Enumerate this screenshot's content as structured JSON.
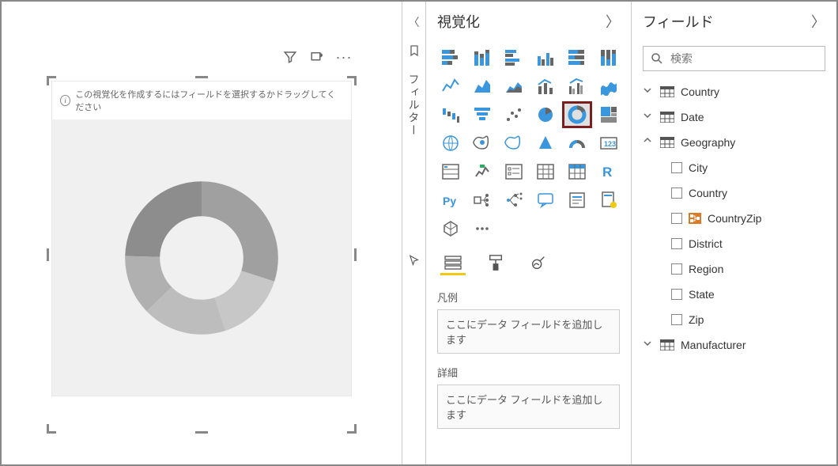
{
  "chart_data": {
    "type": "donut",
    "title": "",
    "values": [
      25,
      15,
      18,
      12,
      30
    ],
    "colors": [
      "#8d8d8d",
      "#c7c7c7",
      "#bdbdbd",
      "#b0b0b0",
      "#a0a0a0"
    ]
  },
  "canvas": {
    "info_message": "この視覚化を作成するにはフィールドを選択するかドラッグしてください"
  },
  "filter_rail": {
    "label": "フィルター"
  },
  "viz_pane": {
    "title": "視覚化",
    "gallery_names": [
      "stacked-bar",
      "stacked-column",
      "clustered-bar",
      "clustered-column",
      "hundred-stacked-bar",
      "hundred-stacked-column",
      "line",
      "area",
      "stacked-area",
      "line-stacked-column",
      "line-clustered-column",
      "ribbon",
      "waterfall",
      "funnel",
      "scatter",
      "pie",
      "donut",
      "treemap",
      "map",
      "filled-map",
      "shape-map",
      "azure-map",
      "gauge",
      "card",
      "multi-row-card",
      "kpi",
      "slicer",
      "table",
      "matrix",
      "r-visual",
      "python-visual",
      "key-influencers",
      "decomposition-tree",
      "qa",
      "narrative",
      "paginated",
      "app-source",
      "more"
    ],
    "selected": "donut",
    "wells": {
      "legend_label": "凡例",
      "legend_placeholder": "ここにデータ フィールドを追加します",
      "details_label": "詳細",
      "details_placeholder": "ここにデータ フィールドを追加します"
    }
  },
  "fields_pane": {
    "title": "フィールド",
    "search_placeholder": "検索",
    "tables": [
      {
        "name": "Country",
        "expanded": false
      },
      {
        "name": "Date",
        "expanded": false
      },
      {
        "name": "Geography",
        "expanded": true,
        "fields": [
          {
            "name": "City",
            "type": "text"
          },
          {
            "name": "Country",
            "type": "text"
          },
          {
            "name": "CountryZip",
            "type": "hierarchy"
          },
          {
            "name": "District",
            "type": "text"
          },
          {
            "name": "Region",
            "type": "text"
          },
          {
            "name": "State",
            "type": "text"
          },
          {
            "name": "Zip",
            "type": "text"
          }
        ]
      },
      {
        "name": "Manufacturer",
        "expanded": false
      }
    ]
  }
}
